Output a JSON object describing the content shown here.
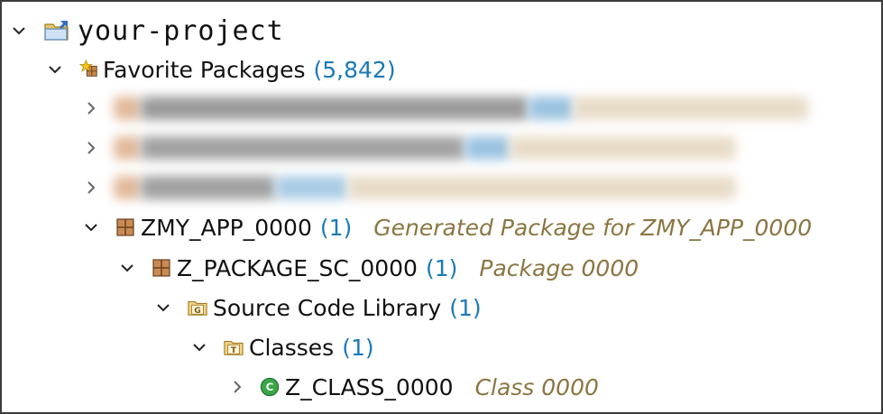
{
  "project": {
    "name": "your-project"
  },
  "favorites": {
    "label": "Favorite Packages",
    "count": "(5,842)"
  },
  "tree": [
    {
      "id": "zmy_app",
      "label": "ZMY_APP_0000",
      "count": "(1)",
      "desc": "Generated Package for ZMY_APP_0000"
    },
    {
      "id": "z_package",
      "label": "Z_PACKAGE_SC_0000",
      "count": "(1)",
      "desc": "Package 0000"
    },
    {
      "id": "source_lib",
      "label": "Source Code Library",
      "count": "(1)"
    },
    {
      "id": "classes",
      "label": "Classes",
      "count": "(1)"
    },
    {
      "id": "z_class",
      "label": "Z_CLASS_0000",
      "desc": "Class 0000"
    }
  ],
  "colors": {
    "count": "#1a7ab8",
    "description": "#8b7642",
    "border": "#3c3c3c"
  },
  "icons": {
    "project": "project-folder-icon",
    "favorites": "favorite-packages-star-icon",
    "package": "package-icon",
    "source_library": "source-library-g-folder-icon",
    "classes": "classes-t-folder-icon",
    "class": "class-c-icon"
  }
}
